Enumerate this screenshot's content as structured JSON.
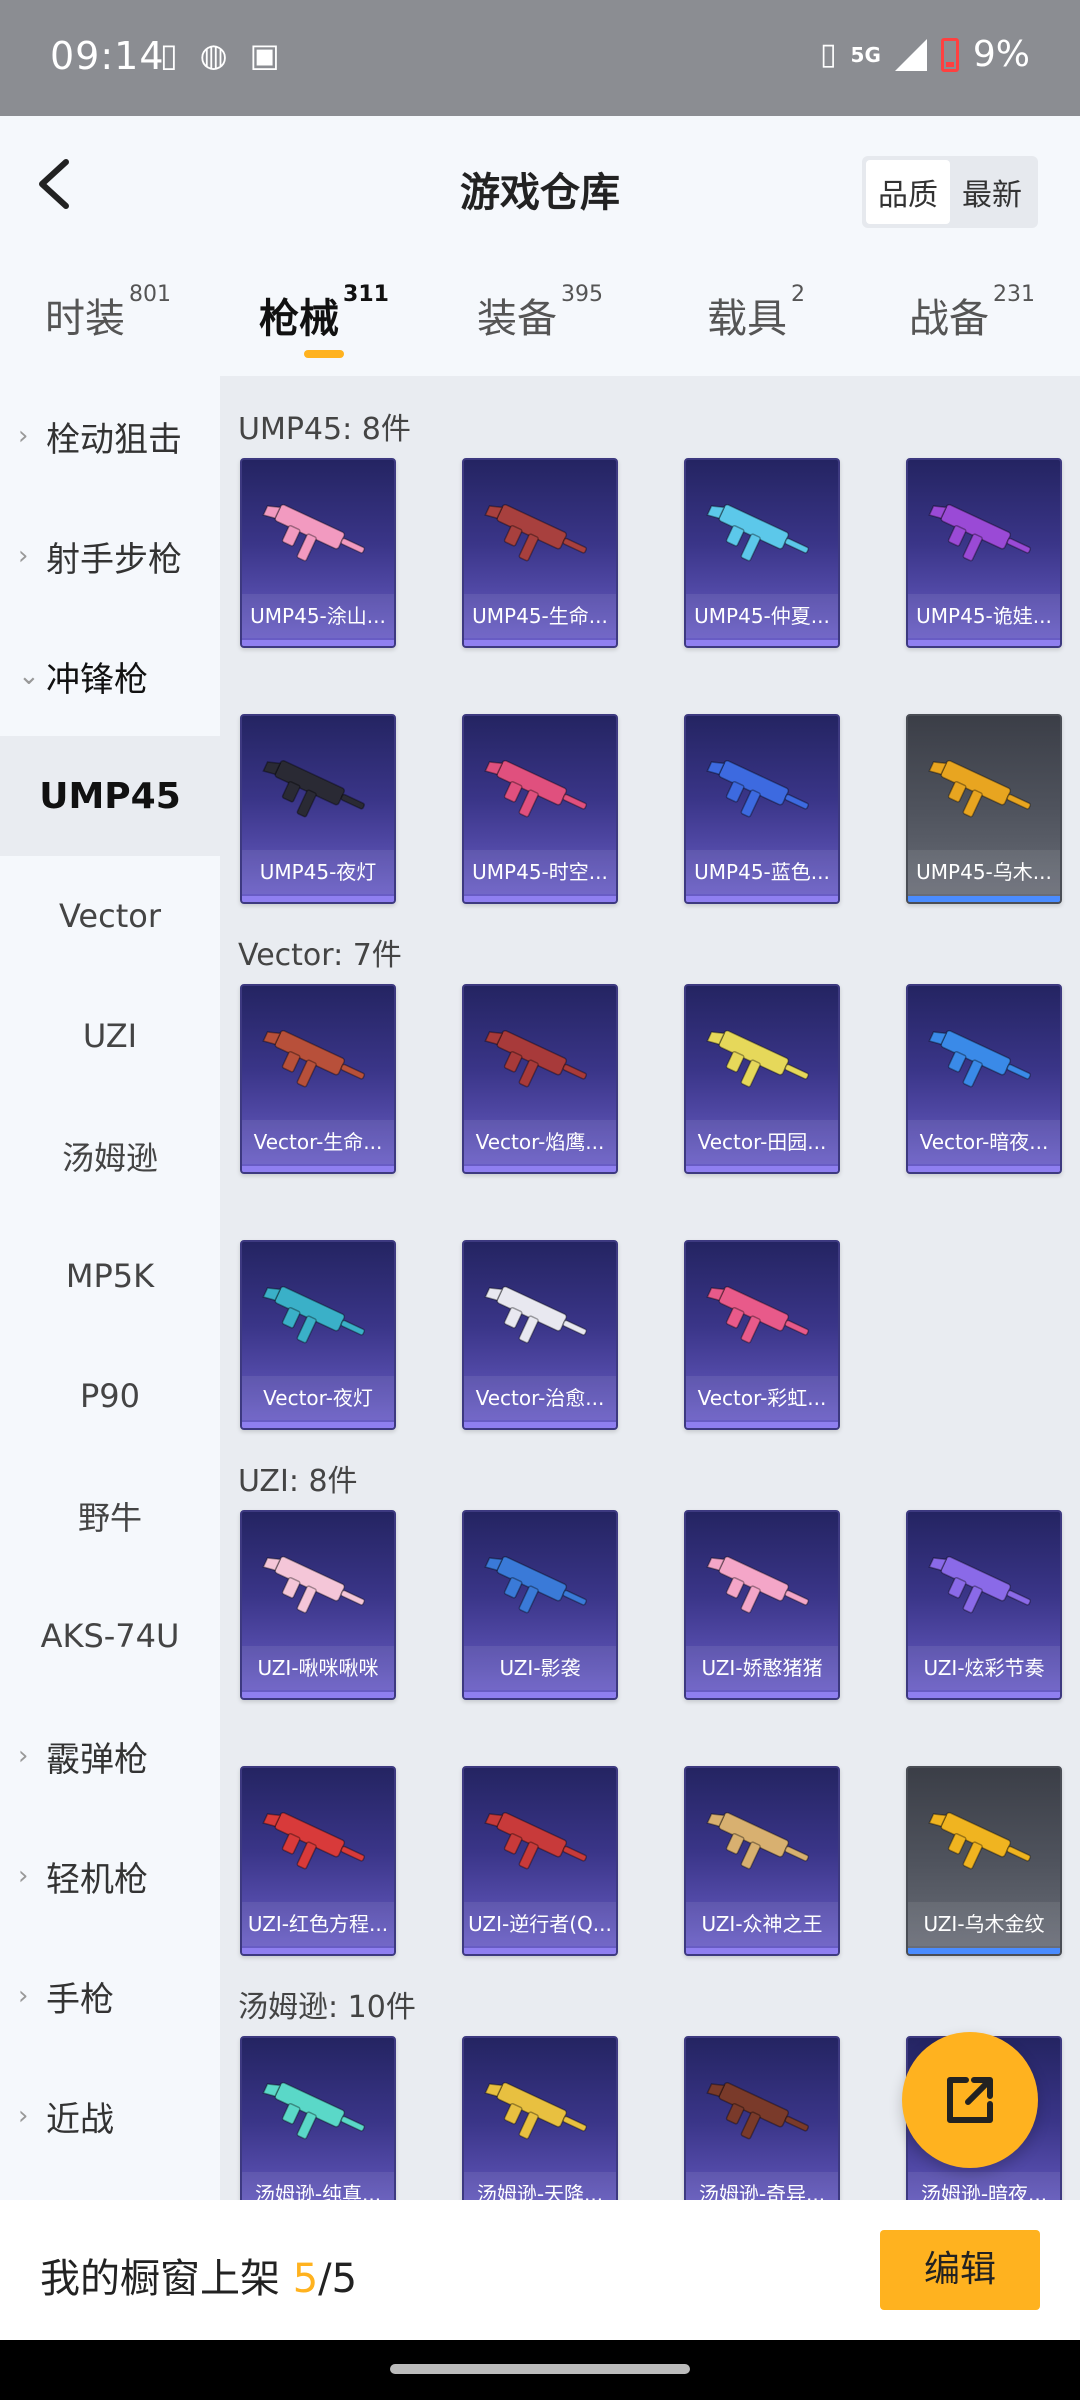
{
  "status_bar": {
    "time": "09:14",
    "network": "5G",
    "battery": "9%"
  },
  "header": {
    "title": "游戏仓库",
    "sort_options": [
      "品质",
      "最新"
    ],
    "sort_active": 0
  },
  "tabs": [
    {
      "label": "时装",
      "count": "801"
    },
    {
      "label": "枪械",
      "count": "311"
    },
    {
      "label": "装备",
      "count": "395"
    },
    {
      "label": "载具",
      "count": "2"
    },
    {
      "label": "战备",
      "count": "231"
    }
  ],
  "active_tab": 1,
  "sidebar": {
    "items": [
      {
        "label": "栓动狙击",
        "type": "group",
        "expanded": false
      },
      {
        "label": "射手步枪",
        "type": "group",
        "expanded": false
      },
      {
        "label": "冲锋枪",
        "type": "group",
        "expanded": true
      },
      {
        "label": "UMP45",
        "type": "sub",
        "selected": true
      },
      {
        "label": "Vector",
        "type": "sub"
      },
      {
        "label": "UZI",
        "type": "sub"
      },
      {
        "label": "汤姆逊",
        "type": "sub"
      },
      {
        "label": "MP5K",
        "type": "sub"
      },
      {
        "label": "P90",
        "type": "sub"
      },
      {
        "label": "野牛",
        "type": "sub"
      },
      {
        "label": "AKS-74U",
        "type": "sub"
      },
      {
        "label": "霰弹枪",
        "type": "group",
        "expanded": false
      },
      {
        "label": "轻机枪",
        "type": "group",
        "expanded": false
      },
      {
        "label": "手枪",
        "type": "group",
        "expanded": false
      },
      {
        "label": "近战",
        "type": "group",
        "expanded": false
      }
    ]
  },
  "sections": [
    {
      "title": "UMP45: 8件",
      "items": [
        {
          "name": "UMP45-涂山...",
          "color": "#f29ac0",
          "gray": false
        },
        {
          "name": "UMP45-生命...",
          "color": "#a8403e",
          "gray": false
        },
        {
          "name": "UMP45-仲夏...",
          "color": "#5cc8ea",
          "gray": false
        },
        {
          "name": "UMP45-诡娃...",
          "color": "#9a4ad6",
          "gray": false
        },
        {
          "name": "UMP45-夜灯",
          "color": "#2a2a34",
          "gray": false
        },
        {
          "name": "UMP45-时空...",
          "color": "#e0507e",
          "gray": false
        },
        {
          "name": "UMP45-蓝色...",
          "color": "#3d6ae0",
          "gray": false
        },
        {
          "name": "UMP45-乌木...",
          "color": "#e8a520",
          "gray": true
        }
      ]
    },
    {
      "title": "Vector: 7件",
      "items": [
        {
          "name": "Vector-生命...",
          "color": "#b8503a",
          "gray": false
        },
        {
          "name": "Vector-焰鹰...",
          "color": "#a83a3a",
          "gray": false
        },
        {
          "name": "Vector-田园...",
          "color": "#e6d85a",
          "gray": false
        },
        {
          "name": "Vector-暗夜...",
          "color": "#3a8ae8",
          "gray": false
        },
        {
          "name": "Vector-夜灯",
          "color": "#3ab0c8",
          "gray": false
        },
        {
          "name": "Vector-治愈...",
          "color": "#e8e8f0",
          "gray": false
        },
        {
          "name": "Vector-彩虹...",
          "color": "#e85a8a",
          "gray": false
        }
      ]
    },
    {
      "title": "UZI: 8件",
      "items": [
        {
          "name": "UZI-啾咪啾咪",
          "color": "#f4c6d8",
          "gray": false
        },
        {
          "name": "UZI-影袭",
          "color": "#3a7ad8",
          "gray": false
        },
        {
          "name": "UZI-娇憨猪猪",
          "color": "#f4a6c8",
          "gray": false
        },
        {
          "name": "UZI-炫彩节奏",
          "color": "#8a6ae8",
          "gray": false
        },
        {
          "name": "UZI-红色方程...",
          "color": "#d83a3a",
          "gray": false
        },
        {
          "name": "UZI-逆行者(Q...",
          "color": "#c83a3a",
          "gray": false
        },
        {
          "name": "UZI-众神之王",
          "color": "#d8b070",
          "gray": false
        },
        {
          "name": "UZI-乌木金纹",
          "color": "#f0b420",
          "gray": true
        }
      ]
    },
    {
      "title": "汤姆逊: 10件",
      "items": [
        {
          "name": "汤姆逊-纯真...",
          "color": "#5ad8c8",
          "gray": false
        },
        {
          "name": "汤姆逊-天降...",
          "color": "#e8c040",
          "gray": false
        },
        {
          "name": "汤姆逊-奇异...",
          "color": "#7a3a2a",
          "gray": false
        },
        {
          "name": "汤姆逊-暗夜...",
          "color": "#4a4a8a",
          "gray": false
        }
      ]
    }
  ],
  "bottom_bar": {
    "label": "我的橱窗上架 ",
    "current": "5",
    "total": "/5",
    "edit_label": "编辑"
  }
}
